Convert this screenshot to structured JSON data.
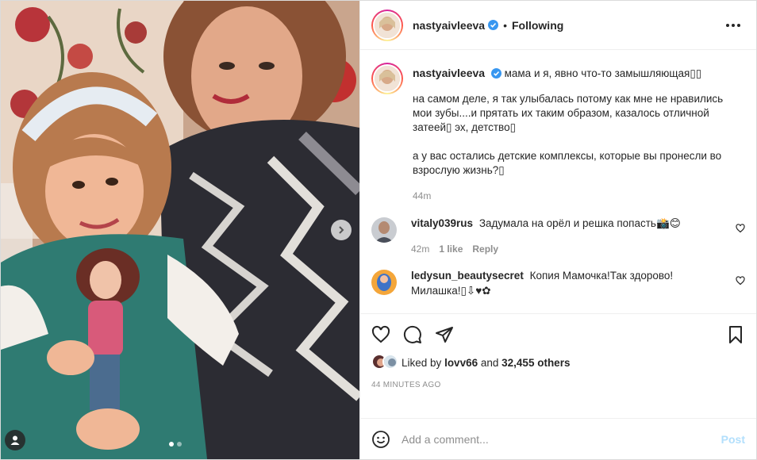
{
  "header": {
    "username": "nastyaivleeva",
    "separator": "•",
    "follow_state": "Following"
  },
  "caption": {
    "username": "nastyaivleeva",
    "line1": "мама и я, явно что-то замышляющая▯▯",
    "para2": "на самом деле, я так улыбалась потому как мне не нравились мои зубы....и прятать их таким образом, казалось отличной затеей▯ эх, детство▯",
    "para3": "а у вас остались детские комплексы, которые вы пронесли во взрослую жизнь?▯",
    "time": "44m"
  },
  "comments": [
    {
      "username": "vitaly039rus",
      "text": "Задумала на орёл и решка попасть📸😊",
      "time": "42m",
      "likes": "1 like",
      "reply": "Reply"
    },
    {
      "username": "ledysun_beautysecret",
      "text": "Копия Мамочка!Так здорово! Милашка!▯⇩♥✿"
    }
  ],
  "actions": {
    "liked_by_prefix": "Liked by",
    "liked_by_user": "lovv66",
    "and_word": "and",
    "others": "32,455 others",
    "timestamp": "44 MINUTES AGO"
  },
  "add_comment": {
    "placeholder": "Add a comment...",
    "post_label": "Post"
  },
  "colors": {
    "verified": "#3897f0",
    "muted": "#8e8e8e",
    "post_disabled": "#b2dffc"
  }
}
